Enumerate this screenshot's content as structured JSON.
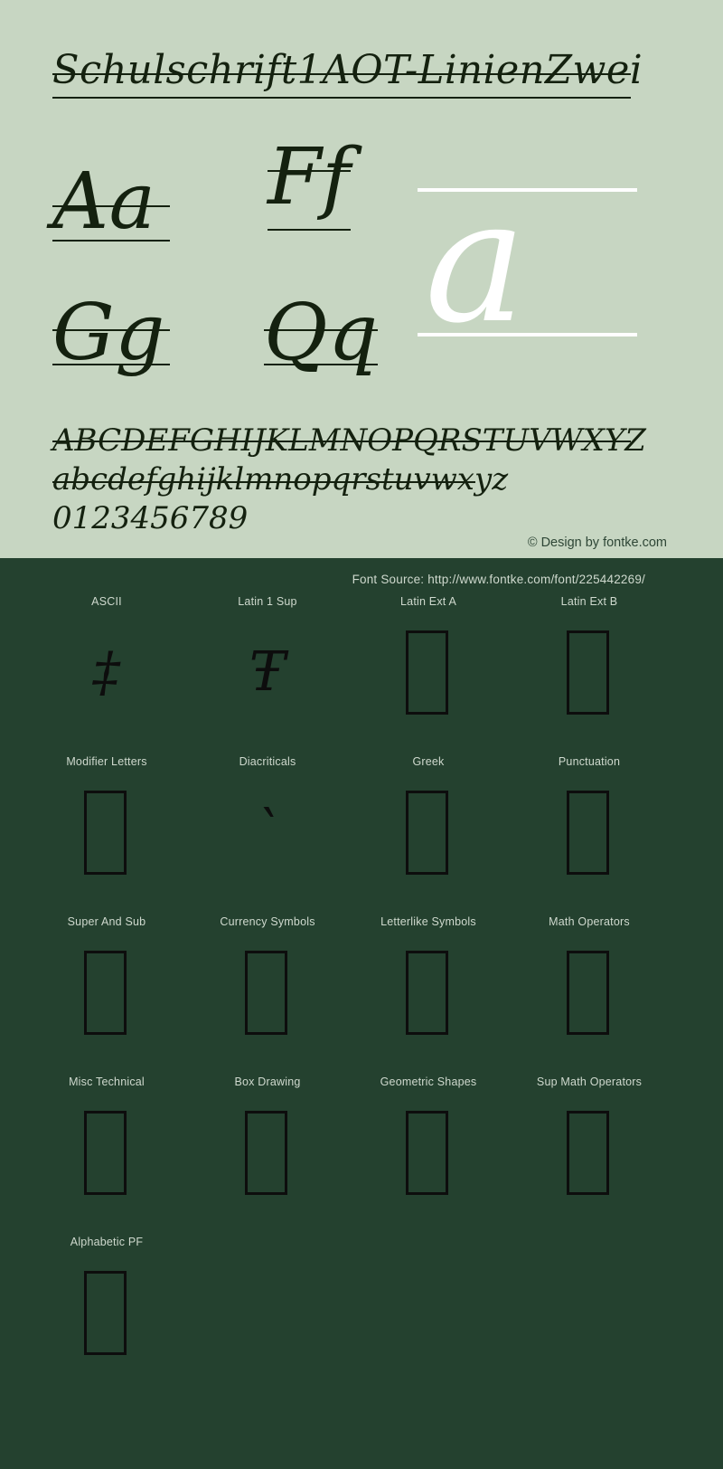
{
  "specimen": {
    "title": "Schulschrift1AOT-LinienZwei",
    "bg_color": "#c7d6c2",
    "ink_color": "#14210f",
    "pairs": [
      {
        "name": "pair-aa",
        "text": "Aa"
      },
      {
        "name": "pair-ff",
        "text": "Ff"
      },
      {
        "name": "pair-gg",
        "text": "Gg"
      },
      {
        "name": "pair-qq",
        "text": "Qq"
      }
    ],
    "feature_glyph": "a",
    "feature_glyph_color": "#ffffff",
    "alphabet_upper": "ABCDEFGHIJKLMNOPQRSTUVWXYZ",
    "alphabet_lower": "abcdefghijklmnopqrstuvwxyz",
    "digits": "0123456789",
    "credit": "© Design by fontke.com"
  },
  "blocks_panel": {
    "bg_color": "#24412f",
    "source": "Font Source: http://www.fontke.com/font/225442269/",
    "rows": [
      [
        {
          "label": "ASCII",
          "sample": "glyph",
          "glyph": "‡"
        },
        {
          "label": "Latin 1 Sup",
          "sample": "glyph",
          "glyph": "Ŧ"
        },
        {
          "label": "Latin Ext A",
          "sample": "tofu"
        },
        {
          "label": "Latin Ext B",
          "sample": "tofu"
        }
      ],
      [
        {
          "label": "Modifier Letters",
          "sample": "tofu"
        },
        {
          "label": "Diacriticals",
          "sample": "glyph",
          "glyph": "`"
        },
        {
          "label": "Greek",
          "sample": "tofu"
        },
        {
          "label": "Punctuation",
          "sample": "tofu"
        }
      ],
      [
        {
          "label": "Super And Sub",
          "sample": "tofu"
        },
        {
          "label": "Currency Symbols",
          "sample": "tofu"
        },
        {
          "label": "Letterlike Symbols",
          "sample": "tofu"
        },
        {
          "label": "Math Operators",
          "sample": "tofu"
        }
      ],
      [
        {
          "label": "Misc Technical",
          "sample": "tofu"
        },
        {
          "label": "Box Drawing",
          "sample": "tofu"
        },
        {
          "label": "Geometric Shapes",
          "sample": "tofu"
        },
        {
          "label": "Sup Math Operators",
          "sample": "tofu"
        }
      ],
      [
        {
          "label": "Alphabetic PF",
          "sample": "tofu"
        }
      ]
    ]
  }
}
